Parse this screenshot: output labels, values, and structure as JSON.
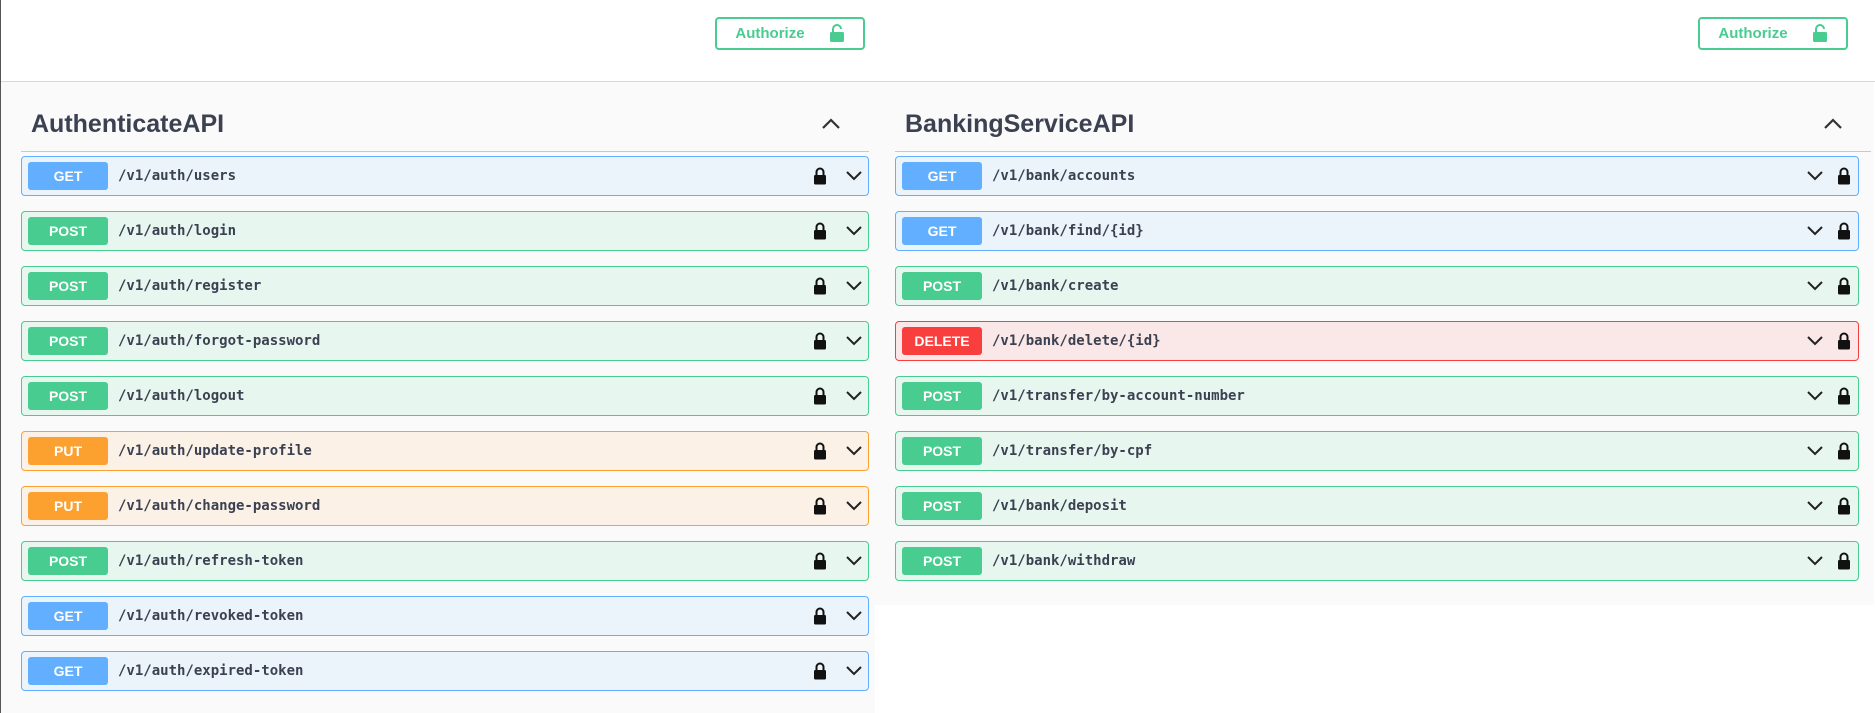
{
  "topbar": {
    "authorize_label": "Authorize",
    "accent": "#49cc90"
  },
  "colors": {
    "get": "#61affe",
    "post": "#49cc90",
    "put": "#fca130",
    "delete": "#f93e3e",
    "title": "#3b4151"
  },
  "icons": {
    "authorize": "lock-open-icon",
    "operation_lock": "lock-icon",
    "expand": "chevron-down-icon",
    "collapse": "chevron-up-icon"
  },
  "sections": [
    {
      "title": "AuthenticateAPI",
      "operations": [
        {
          "method": "GET",
          "path": "/v1/auth/users"
        },
        {
          "method": "POST",
          "path": "/v1/auth/login"
        },
        {
          "method": "POST",
          "path": "/v1/auth/register"
        },
        {
          "method": "POST",
          "path": "/v1/auth/forgot-password"
        },
        {
          "method": "POST",
          "path": "/v1/auth/logout"
        },
        {
          "method": "PUT",
          "path": "/v1/auth/update-profile"
        },
        {
          "method": "PUT",
          "path": "/v1/auth/change-password"
        },
        {
          "method": "POST",
          "path": "/v1/auth/refresh-token"
        },
        {
          "method": "GET",
          "path": "/v1/auth/revoked-token"
        },
        {
          "method": "GET",
          "path": "/v1/auth/expired-token"
        }
      ]
    },
    {
      "title": "BankingServiceAPI",
      "operations": [
        {
          "method": "GET",
          "path": "/v1/bank/accounts"
        },
        {
          "method": "GET",
          "path": "/v1/bank/find/{id}"
        },
        {
          "method": "POST",
          "path": "/v1/bank/create"
        },
        {
          "method": "DELETE",
          "path": "/v1/bank/delete/{id}"
        },
        {
          "method": "POST",
          "path": "/v1/transfer/by-account-number"
        },
        {
          "method": "POST",
          "path": "/v1/transfer/by-cpf"
        },
        {
          "method": "POST",
          "path": "/v1/bank/deposit"
        },
        {
          "method": "POST",
          "path": "/v1/bank/withdraw"
        }
      ]
    }
  ]
}
